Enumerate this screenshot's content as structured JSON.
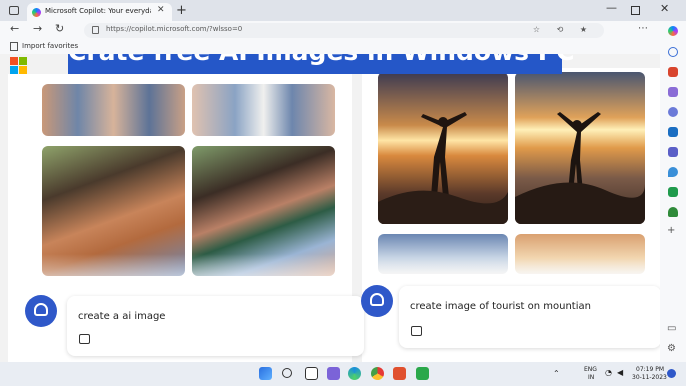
{
  "browser": {
    "tab_title": "Microsoft Copilot: Your everyday",
    "url": "https://copilot.microsoft.com/?wlsso=0",
    "favorites_label": "Import favorites"
  },
  "banner": {
    "text": "Crate free AI Images in Windows PC"
  },
  "left_chat": {
    "prompt": "create a ai image"
  },
  "right_chat": {
    "prompt": "create image of tourist on mountian"
  },
  "taskbar": {
    "language_line1": "ENG",
    "language_line2": "IN",
    "time": "07:19 PM",
    "date": "30-11-2023"
  },
  "icons": {
    "microsoft_logo_colors": [
      "#f25022",
      "#7fba00",
      "#00a4ef",
      "#ffb900"
    ],
    "accent": "#2f58c9"
  }
}
